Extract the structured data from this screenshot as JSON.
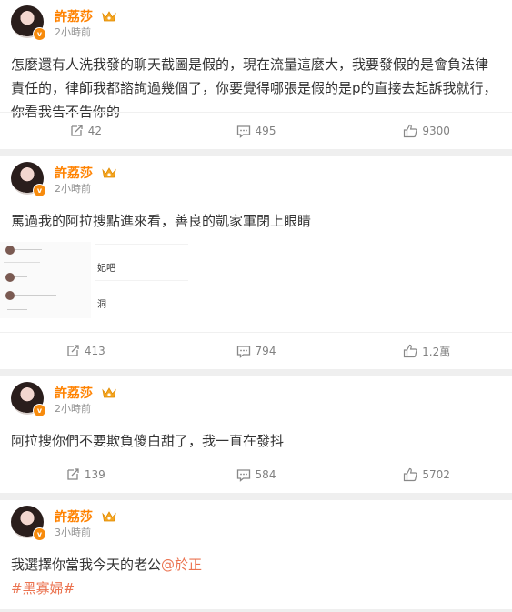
{
  "author": {
    "name": "許荔莎"
  },
  "posts": [
    {
      "time": "2小時前",
      "text": "怎麼還有人洗我發的聊天截圖是假的，現在流量這麼大，我要發假的是會負法律責任的，律師我都諮詢過幾個了，你要覺得哪張是假的是p的直接去起訴我就行，你看我告不告你的",
      "reposts": "42",
      "comments": "495",
      "likes": "9300"
    },
    {
      "time": "2小時前",
      "text": "罵過我的阿拉搜點進來看，善良的凱家軍閉上眼睛",
      "image_snippets": [
        "妃吧",
        "洞"
      ],
      "reposts": "413",
      "comments": "794",
      "likes": "1.2萬"
    },
    {
      "time": "2小時前",
      "text": "阿拉搜你們不要欺負傻白甜了，我一直在發抖",
      "reposts": "139",
      "comments": "584",
      "likes": "5702"
    },
    {
      "time": "3小時前",
      "text": "我選擇你當我今天的老公",
      "mention": "@於正",
      "hashtag": "#黑寡婦#"
    }
  ],
  "icons": {
    "repost": "repost-icon",
    "comment": "comment-icon",
    "like": "like-icon",
    "crown": "crown-icon",
    "verified": "verified-badge-icon"
  },
  "colors": {
    "name": "#ff8200",
    "link": "#eb7350",
    "muted": "#939393",
    "background": "#efefef"
  }
}
